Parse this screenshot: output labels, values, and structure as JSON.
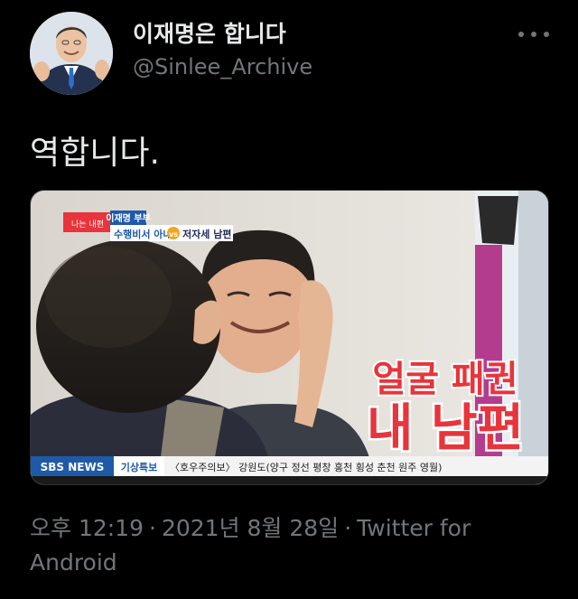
{
  "author": {
    "display_name": "이재명은 합니다",
    "handle": "@Sinlee_Archive"
  },
  "tweet": {
    "text": "역합니다.",
    "time": "오후 12:19",
    "date": "2021년 8월 28일",
    "separator": "·",
    "source": "Twitter for Android"
  },
  "media": {
    "badge_top": "이재명 부부",
    "program_logo": "나는 내편",
    "subtitle_left": "수행비서 아내",
    "subtitle_vs": "vs",
    "subtitle_right": "저자세 남편",
    "caption_line1": "얼굴 패권",
    "caption_line2": "내 남편",
    "ticker_brand": "SBS NEWS",
    "ticker_label": "기상특보",
    "ticker_text": "〈호우주의보〉 강원도(양구 정선 평창 홍천 횡성 춘천 원주 영월)"
  },
  "colors": {
    "background": "#000000",
    "text_primary": "#e7e9ea",
    "text_secondary": "#71767b",
    "caption_red": "#e8343b",
    "sbs_blue": "#1e5aa8"
  }
}
